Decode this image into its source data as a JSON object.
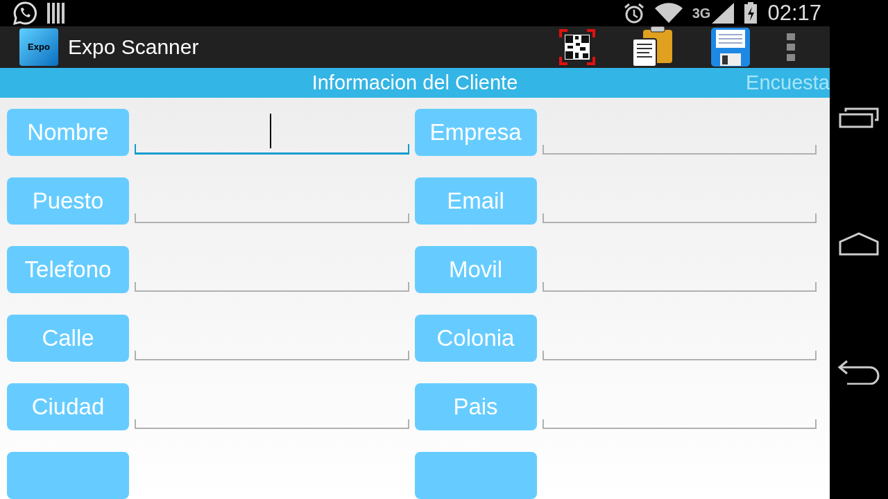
{
  "status_bar": {
    "time": "02:17",
    "network": "3G"
  },
  "action_bar": {
    "title": "Expo Scanner",
    "logo_text": "Expo"
  },
  "tabs": [
    {
      "label": "Informacion del Cliente",
      "selected": true
    },
    {
      "label": "Encuesta",
      "selected": false
    }
  ],
  "fields": [
    {
      "kind": "field",
      "label": "Nombre",
      "focused": true
    },
    {
      "kind": "field",
      "label": "Empresa",
      "focused": false
    },
    {
      "kind": "field",
      "label": "Puesto",
      "focused": false
    },
    {
      "kind": "field",
      "label": "Email",
      "focused": false
    },
    {
      "kind": "field",
      "label": "Telefono",
      "focused": false
    },
    {
      "kind": "field",
      "label": "Movil",
      "focused": false
    },
    {
      "kind": "field",
      "label": "Calle",
      "focused": false
    },
    {
      "kind": "field",
      "label": "Colonia",
      "focused": false
    },
    {
      "kind": "field",
      "label": "Ciudad",
      "focused": false
    },
    {
      "kind": "field",
      "label": "Pais",
      "focused": false
    },
    {
      "kind": "cut"
    },
    {
      "kind": "cut"
    }
  ]
}
